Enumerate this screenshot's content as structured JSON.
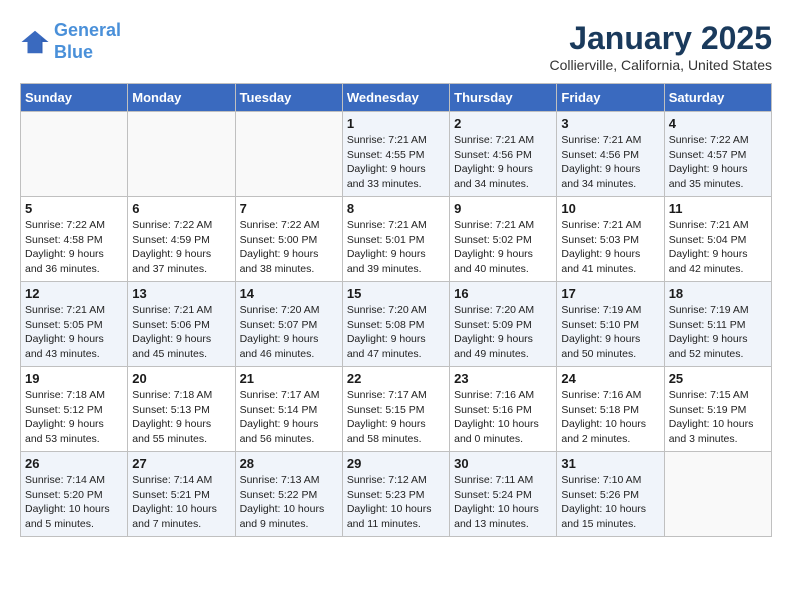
{
  "app": {
    "logo_line1": "General",
    "logo_line2": "Blue"
  },
  "title": "January 2025",
  "subtitle": "Collierville, California, United States",
  "days_of_week": [
    "Sunday",
    "Monday",
    "Tuesday",
    "Wednesday",
    "Thursday",
    "Friday",
    "Saturday"
  ],
  "weeks": [
    [
      {
        "day": "",
        "info": ""
      },
      {
        "day": "",
        "info": ""
      },
      {
        "day": "",
        "info": ""
      },
      {
        "day": "1",
        "info": "Sunrise: 7:21 AM\nSunset: 4:55 PM\nDaylight: 9 hours and 33 minutes."
      },
      {
        "day": "2",
        "info": "Sunrise: 7:21 AM\nSunset: 4:56 PM\nDaylight: 9 hours and 34 minutes."
      },
      {
        "day": "3",
        "info": "Sunrise: 7:21 AM\nSunset: 4:56 PM\nDaylight: 9 hours and 34 minutes."
      },
      {
        "day": "4",
        "info": "Sunrise: 7:22 AM\nSunset: 4:57 PM\nDaylight: 9 hours and 35 minutes."
      }
    ],
    [
      {
        "day": "5",
        "info": "Sunrise: 7:22 AM\nSunset: 4:58 PM\nDaylight: 9 hours and 36 minutes."
      },
      {
        "day": "6",
        "info": "Sunrise: 7:22 AM\nSunset: 4:59 PM\nDaylight: 9 hours and 37 minutes."
      },
      {
        "day": "7",
        "info": "Sunrise: 7:22 AM\nSunset: 5:00 PM\nDaylight: 9 hours and 38 minutes."
      },
      {
        "day": "8",
        "info": "Sunrise: 7:21 AM\nSunset: 5:01 PM\nDaylight: 9 hours and 39 minutes."
      },
      {
        "day": "9",
        "info": "Sunrise: 7:21 AM\nSunset: 5:02 PM\nDaylight: 9 hours and 40 minutes."
      },
      {
        "day": "10",
        "info": "Sunrise: 7:21 AM\nSunset: 5:03 PM\nDaylight: 9 hours and 41 minutes."
      },
      {
        "day": "11",
        "info": "Sunrise: 7:21 AM\nSunset: 5:04 PM\nDaylight: 9 hours and 42 minutes."
      }
    ],
    [
      {
        "day": "12",
        "info": "Sunrise: 7:21 AM\nSunset: 5:05 PM\nDaylight: 9 hours and 43 minutes."
      },
      {
        "day": "13",
        "info": "Sunrise: 7:21 AM\nSunset: 5:06 PM\nDaylight: 9 hours and 45 minutes."
      },
      {
        "day": "14",
        "info": "Sunrise: 7:20 AM\nSunset: 5:07 PM\nDaylight: 9 hours and 46 minutes."
      },
      {
        "day": "15",
        "info": "Sunrise: 7:20 AM\nSunset: 5:08 PM\nDaylight: 9 hours and 47 minutes."
      },
      {
        "day": "16",
        "info": "Sunrise: 7:20 AM\nSunset: 5:09 PM\nDaylight: 9 hours and 49 minutes."
      },
      {
        "day": "17",
        "info": "Sunrise: 7:19 AM\nSunset: 5:10 PM\nDaylight: 9 hours and 50 minutes."
      },
      {
        "day": "18",
        "info": "Sunrise: 7:19 AM\nSunset: 5:11 PM\nDaylight: 9 hours and 52 minutes."
      }
    ],
    [
      {
        "day": "19",
        "info": "Sunrise: 7:18 AM\nSunset: 5:12 PM\nDaylight: 9 hours and 53 minutes."
      },
      {
        "day": "20",
        "info": "Sunrise: 7:18 AM\nSunset: 5:13 PM\nDaylight: 9 hours and 55 minutes."
      },
      {
        "day": "21",
        "info": "Sunrise: 7:17 AM\nSunset: 5:14 PM\nDaylight: 9 hours and 56 minutes."
      },
      {
        "day": "22",
        "info": "Sunrise: 7:17 AM\nSunset: 5:15 PM\nDaylight: 9 hours and 58 minutes."
      },
      {
        "day": "23",
        "info": "Sunrise: 7:16 AM\nSunset: 5:16 PM\nDaylight: 10 hours and 0 minutes."
      },
      {
        "day": "24",
        "info": "Sunrise: 7:16 AM\nSunset: 5:18 PM\nDaylight: 10 hours and 2 minutes."
      },
      {
        "day": "25",
        "info": "Sunrise: 7:15 AM\nSunset: 5:19 PM\nDaylight: 10 hours and 3 minutes."
      }
    ],
    [
      {
        "day": "26",
        "info": "Sunrise: 7:14 AM\nSunset: 5:20 PM\nDaylight: 10 hours and 5 minutes."
      },
      {
        "day": "27",
        "info": "Sunrise: 7:14 AM\nSunset: 5:21 PM\nDaylight: 10 hours and 7 minutes."
      },
      {
        "day": "28",
        "info": "Sunrise: 7:13 AM\nSunset: 5:22 PM\nDaylight: 10 hours and 9 minutes."
      },
      {
        "day": "29",
        "info": "Sunrise: 7:12 AM\nSunset: 5:23 PM\nDaylight: 10 hours and 11 minutes."
      },
      {
        "day": "30",
        "info": "Sunrise: 7:11 AM\nSunset: 5:24 PM\nDaylight: 10 hours and 13 minutes."
      },
      {
        "day": "31",
        "info": "Sunrise: 7:10 AM\nSunset: 5:26 PM\nDaylight: 10 hours and 15 minutes."
      },
      {
        "day": "",
        "info": ""
      }
    ]
  ]
}
